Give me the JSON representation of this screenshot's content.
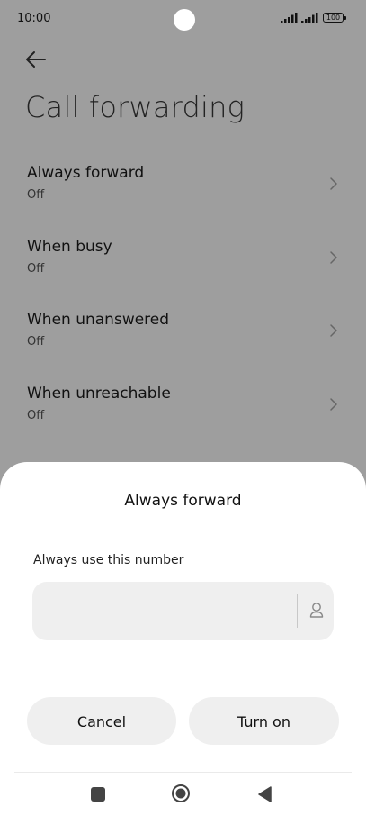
{
  "status_bar": {
    "time": "10:00",
    "battery": "100"
  },
  "header": {
    "title": "Call forwarding"
  },
  "settings": {
    "items": [
      {
        "label": "Always forward",
        "status": "Off"
      },
      {
        "label": "When busy",
        "status": "Off"
      },
      {
        "label": "When unanswered",
        "status": "Off"
      },
      {
        "label": "When unreachable",
        "status": "Off"
      }
    ]
  },
  "dialog": {
    "title": "Always forward",
    "field_label": "Always use this number",
    "number_value": "",
    "cancel_label": "Cancel",
    "turn_on_label": "Turn on"
  },
  "icons": {
    "back": "arrow-left-icon",
    "chevron": "chevron-right-icon",
    "contact": "person-icon",
    "nav_recents": "square-icon",
    "nav_home": "circle-icon",
    "nav_back": "triangle-back-icon"
  },
  "colors": {
    "dim_background": "#9e9e9e",
    "sheet_background": "#ffffff",
    "button_background": "#efefef"
  }
}
